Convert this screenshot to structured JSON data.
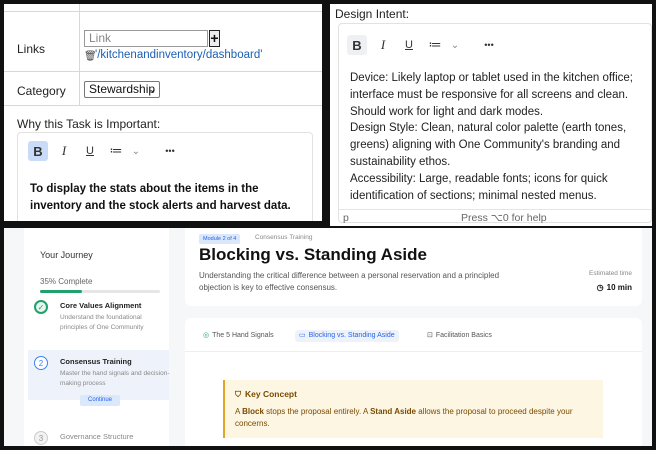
{
  "task_form": {
    "links_label": "Links",
    "link_placeholder": "Link",
    "add_symbol": "+",
    "link_value": "'/kitchenandinventory/dashboard'",
    "category_label": "Category",
    "category_value": "Stewardship",
    "why_label": "Why this Task is Important:",
    "toolbar": {
      "bold": "B",
      "italic": "I",
      "underline": "U",
      "list": "≔",
      "chevron": "⌄",
      "more": "•••"
    },
    "why_text": "To display the stats about the items in the inventory and the stock alerts and harvest data."
  },
  "design_intent": {
    "title": "Design Intent:",
    "toolbar": {
      "bold": "B",
      "italic": "I",
      "underline": "U",
      "list": "≔",
      "chevron": "⌄",
      "more": "•••"
    },
    "paragraphs": [
      "Device: Likely laptop or tablet used in the kitchen office; interface must be responsive for all screens and clean. Should work for light and dark modes.",
      "Design Style: Clean, natural color palette (earth tones, greens) aligning with One Community's branding and sustainability ethos.",
      "Accessibility: Large, readable fonts; icons for quick identification of sections; minimal nested menus."
    ],
    "footer_tag": "p",
    "footer_hint": "Press ⌥0 for help"
  },
  "course": {
    "sidebar": {
      "title": "Your Journey",
      "progress_text": "35% Complete",
      "progress_fraction": 0.35,
      "steps": [
        {
          "num": "✓",
          "title": "Core Values Alignment",
          "desc": "Understand the foundational principles of One Community"
        },
        {
          "num": "2",
          "title": "Consensus Training",
          "desc": "Master the hand signals and decision-making process",
          "button": "Continue"
        },
        {
          "num": "3",
          "title": "Governance Structure"
        }
      ]
    },
    "header": {
      "module_badge": "Module 2 of 4",
      "module_category": "Consensus Training",
      "title": "Blocking vs. Standing Aside",
      "subtitle": "Understanding the critical difference between a personal reservation and a principled objection is key to effective consensus.",
      "estimated_label": "Estimated time",
      "estimated_value": "10 min"
    },
    "tabs": [
      {
        "label": "The 5 Hand Signals",
        "icon": "◎"
      },
      {
        "label": "Blocking vs. Standing Aside",
        "icon": "▭"
      },
      {
        "label": "Facilitation Basics",
        "icon": "⊡"
      }
    ],
    "key_concept": {
      "title": "Key Concept",
      "p1": "A ",
      "block": "Block",
      "p2": " stops the proposal entirely. A ",
      "stand": "Stand Aside",
      "p3": " allows the proposal to proceed despite your concerns."
    }
  },
  "colors": {
    "accent": "#2563eb",
    "success": "#22a06b",
    "warning_bg": "#fdf6e3",
    "warning_text": "#7a4a00"
  }
}
